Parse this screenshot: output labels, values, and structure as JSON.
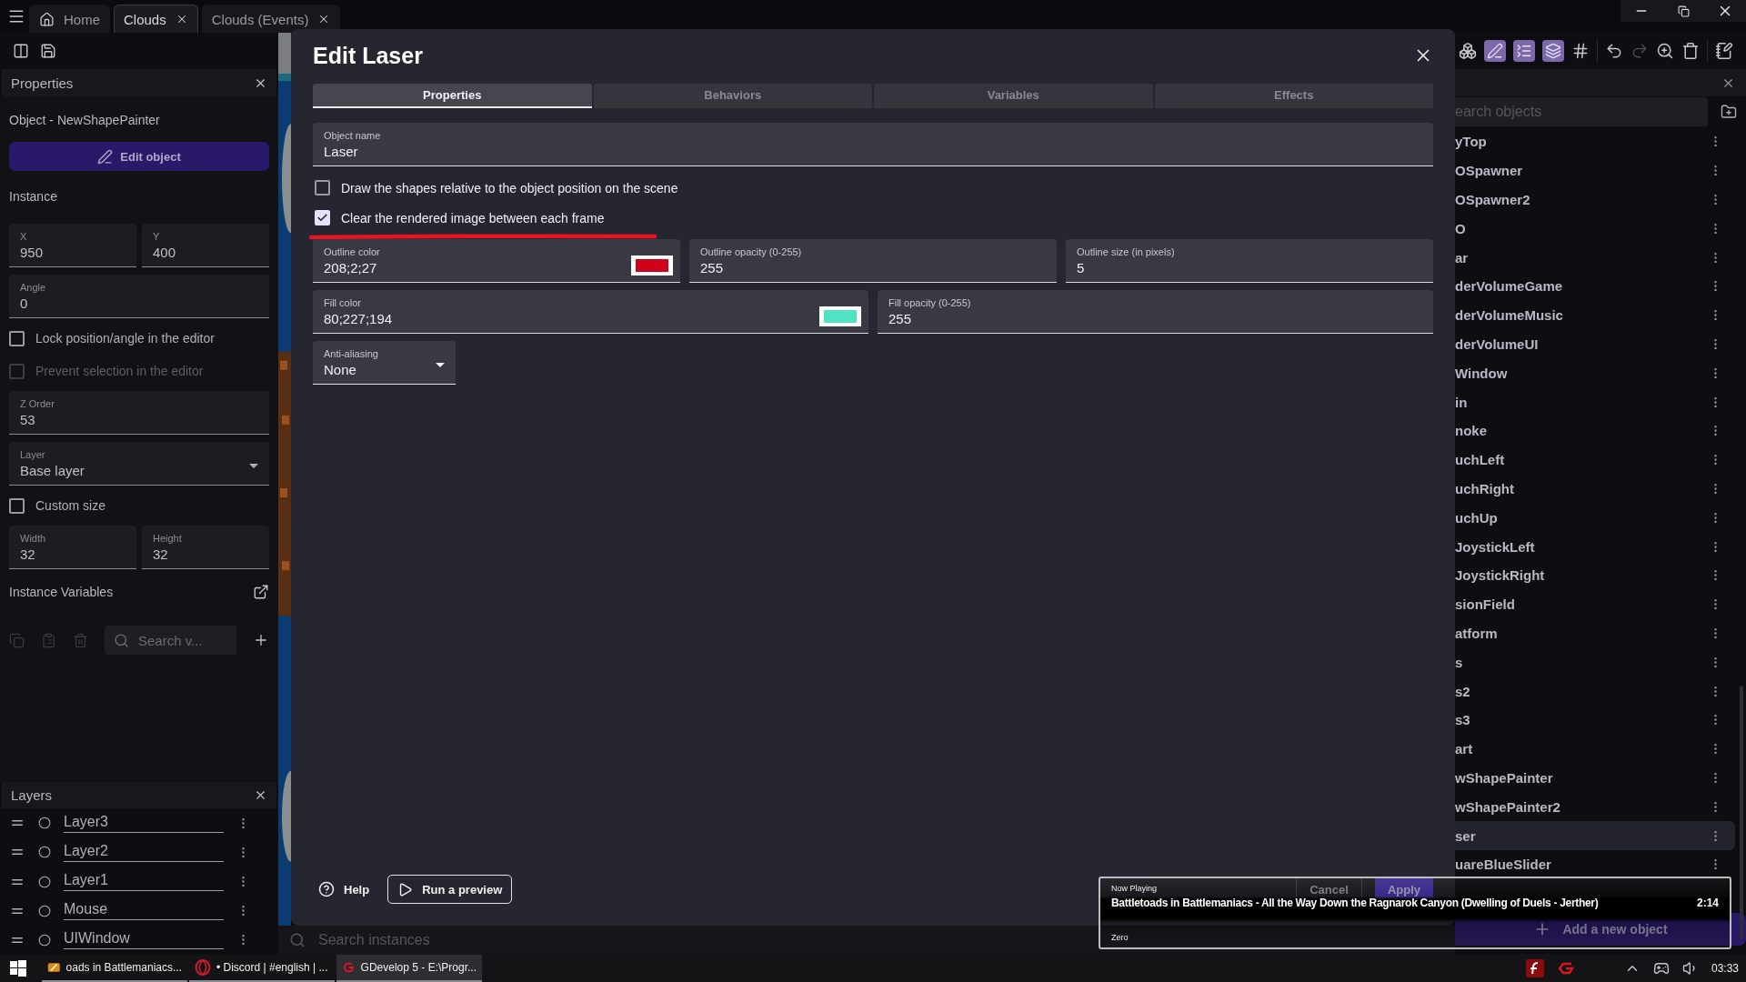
{
  "app_tabs": [
    {
      "label": "Home",
      "kind": "home",
      "selected": false,
      "closable": false
    },
    {
      "label": "Clouds",
      "kind": "scene",
      "selected": true,
      "closable": true
    },
    {
      "label": "Clouds (Events)",
      "kind": "scene",
      "selected": false,
      "closable": true
    }
  ],
  "properties": {
    "title": "Properties",
    "object_line": "Object  - NewShapePainter",
    "edit_button": "Edit object",
    "section": "Instance",
    "rows": [
      {
        "kind": "pair",
        "fields": [
          {
            "label": "X",
            "value": "950"
          },
          {
            "label": "Y",
            "value": "400"
          }
        ]
      },
      {
        "kind": "field",
        "label": "Angle",
        "value": "0"
      },
      {
        "kind": "checkbox",
        "label": "Lock position/angle in the editor",
        "checked": false,
        "disabled": false
      },
      {
        "kind": "checkbox",
        "label": "Prevent selection in the editor",
        "checked": false,
        "disabled": true
      },
      {
        "kind": "field",
        "label": "Z Order",
        "value": "53"
      },
      {
        "kind": "select",
        "label": "Layer",
        "value": "Base layer"
      },
      {
        "kind": "checkbox",
        "label": "Custom size",
        "checked": false,
        "disabled": false
      },
      {
        "kind": "pair",
        "fields": [
          {
            "label": "Width",
            "value": "32"
          },
          {
            "label": "Height",
            "value": "32"
          }
        ]
      }
    ],
    "variables_title": "Instance Variables",
    "variables_search": "Search v..."
  },
  "layers": {
    "title": "Layers",
    "items": [
      "Layer3",
      "Layer2",
      "Layer1",
      "Mouse",
      "UIWindow"
    ]
  },
  "instances_search": "Search instances",
  "dialog": {
    "title": "Edit Laser",
    "tabs": [
      {
        "label": "Properties",
        "selected": true
      },
      {
        "label": "Behaviors",
        "selected": false
      },
      {
        "label": "Variables",
        "selected": false
      },
      {
        "label": "Effects",
        "selected": false
      }
    ],
    "object_name": {
      "label": "Object name",
      "value": "Laser"
    },
    "checkboxes": [
      {
        "label": "Draw the shapes relative to the object position on the scene",
        "checked": false
      },
      {
        "label": "Clear the rendered image between each frame",
        "checked": true
      }
    ],
    "field_rows": [
      {
        "fields": [
          {
            "kind": "color",
            "label": "Outline color",
            "value": "208;2;27",
            "color": "#d0021b"
          },
          {
            "kind": "text",
            "label": "Outline opacity (0-255)",
            "value": "255"
          },
          {
            "kind": "text",
            "label": "Outline size (in pixels)",
            "value": "5"
          }
        ]
      },
      {
        "fields": [
          {
            "kind": "color",
            "label": "Fill color",
            "value": "80;227;194",
            "color": "#50e3c2"
          },
          {
            "kind": "text",
            "label": "Fill opacity (0-255)",
            "value": "255"
          }
        ]
      }
    ],
    "anti_aliasing": {
      "label": "Anti-aliasing",
      "value": "None"
    },
    "help": "Help",
    "preview": "Run a preview",
    "cancel": "Cancel",
    "apply": "Apply"
  },
  "objects": {
    "search_placeholder": "earch objects",
    "items": [
      {
        "name": "yTop",
        "selected": false
      },
      {
        "name": "OSpawner",
        "selected": false
      },
      {
        "name": "OSpawner2",
        "selected": false
      },
      {
        "name": "O",
        "selected": false
      },
      {
        "name": "ar",
        "selected": false
      },
      {
        "name": "derVolumeGame",
        "selected": false
      },
      {
        "name": "derVolumeMusic",
        "selected": false
      },
      {
        "name": "derVolumeUI",
        "selected": false
      },
      {
        "name": "Window",
        "selected": false
      },
      {
        "name": "in",
        "selected": false
      },
      {
        "name": "noke",
        "selected": false
      },
      {
        "name": "uchLeft",
        "selected": false
      },
      {
        "name": "uchRight",
        "selected": false
      },
      {
        "name": "uchUp",
        "selected": false
      },
      {
        "name": "JoystickLeft",
        "selected": false
      },
      {
        "name": "JoystickRight",
        "selected": false
      },
      {
        "name": "sionField",
        "selected": false
      },
      {
        "name": "atform",
        "selected": false
      },
      {
        "name": "s",
        "selected": false
      },
      {
        "name": "s2",
        "selected": false
      },
      {
        "name": "s3",
        "selected": false
      },
      {
        "name": "art",
        "selected": false
      },
      {
        "name": "wShapePainter",
        "selected": false
      },
      {
        "name": "wShapePainter2",
        "selected": false
      },
      {
        "name": "ser",
        "selected": true
      },
      {
        "name": "uareBlueSlider",
        "selected": false
      }
    ],
    "add_button": "Add a new object"
  },
  "now_playing": {
    "heading": "Now Playing",
    "track": "Battletoads in Battlemaniacs - All the Way Down the Ragnarok Canyon (Dwelling of Duels - Jerther)",
    "time": "2:14",
    "artist": "Zero"
  },
  "taskbar": {
    "items": [
      {
        "label": "oads in Battlemaniacs...",
        "kind": "player",
        "selected": false
      },
      {
        "label": "• Discord | #english | ...",
        "kind": "browser",
        "selected": false
      },
      {
        "label": "GDevelop 5 - E:\\Progr...",
        "kind": "gdevelop",
        "selected": true
      }
    ],
    "clock": "03:33"
  }
}
